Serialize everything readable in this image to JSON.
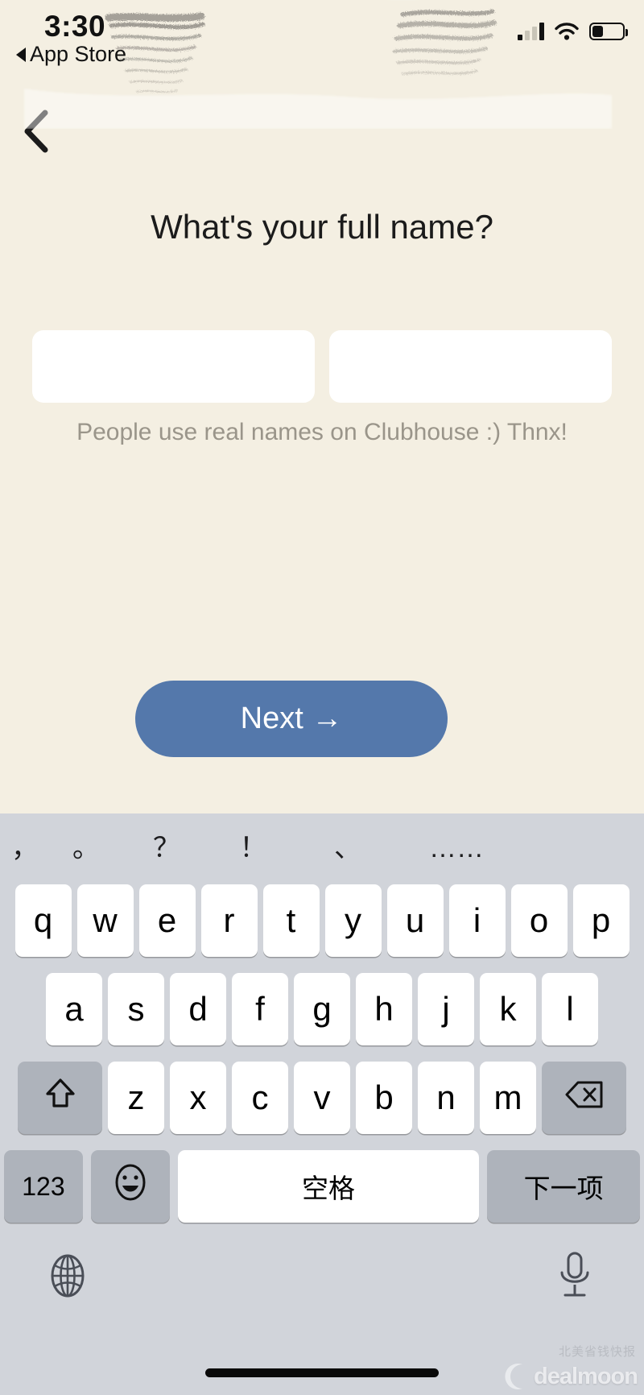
{
  "status_bar": {
    "time": "3:30",
    "return_app": "App Store",
    "signal_icon": "cellular-bars-icon",
    "wifi_icon": "wifi-icon",
    "battery_icon": "battery-icon",
    "battery_level_percent": 32
  },
  "navigation": {
    "back_icon": "chevron-left-icon"
  },
  "screen": {
    "heading": "What's your full name?",
    "helper_text": "People use real names on Clubhouse :) Thnx!",
    "fields": [
      {
        "name": "first-name",
        "value": "",
        "placeholder": "",
        "redacted": true
      },
      {
        "name": "last-name",
        "value": "",
        "placeholder": "",
        "redacted": true
      }
    ],
    "next_button": "Next  →"
  },
  "colors": {
    "background": "#f4efe2",
    "button": "#5478ab",
    "button_text": "#ffffff",
    "helper_text": "#9a958a",
    "keyboard_background": "#d1d4da",
    "key_face": "#ffffff",
    "key_function": "#aeb3bb"
  },
  "keyboard": {
    "punctuation_row": [
      "，",
      "。",
      "？",
      "！",
      "、",
      "……"
    ],
    "row1": [
      "q",
      "w",
      "e",
      "r",
      "t",
      "y",
      "u",
      "i",
      "o",
      "p"
    ],
    "row2": [
      "a",
      "s",
      "d",
      "f",
      "g",
      "h",
      "j",
      "k",
      "l"
    ],
    "row3_letters": [
      "z",
      "x",
      "c",
      "v",
      "b",
      "n",
      "m"
    ],
    "shift_icon": "shift-arrow-icon",
    "backspace_icon": "backspace-icon",
    "numbers_key": "123",
    "emoji_icon": "emoji-smiley-icon",
    "space_key": "空格",
    "enter_key": "下一项",
    "globe_icon": "globe-icon",
    "mic_icon": "microphone-icon"
  },
  "watermark": {
    "brand": "dealmoon",
    "subtitle": "北美省钱快报"
  }
}
